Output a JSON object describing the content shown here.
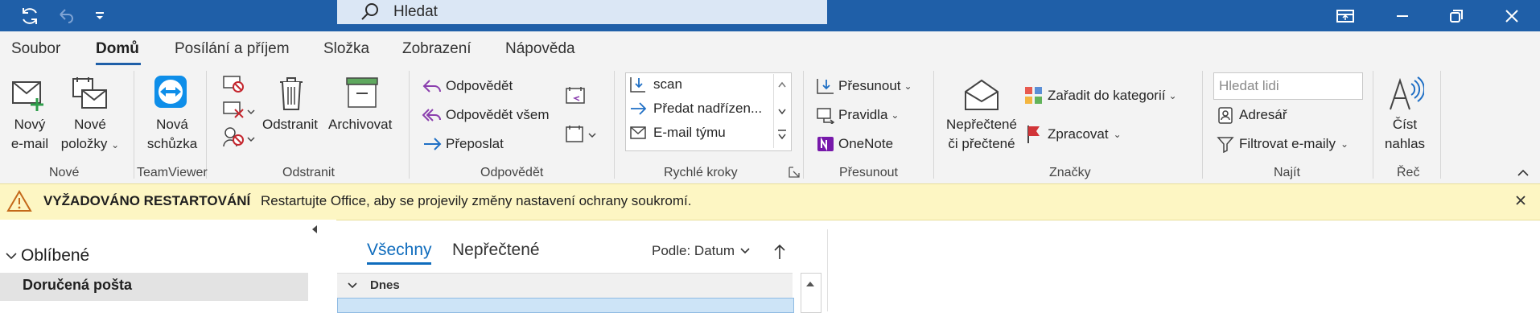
{
  "search": {
    "placeholder": "Hledat"
  },
  "tabs": [
    {
      "label": "Soubor"
    },
    {
      "label": "Domů"
    },
    {
      "label": "Posílání a příjem"
    },
    {
      "label": "Složka"
    },
    {
      "label": "Zobrazení"
    },
    {
      "label": "Nápověda"
    }
  ],
  "ribbon": {
    "new_email": [
      "Nový",
      "e-mail"
    ],
    "new_items": [
      "Nové",
      "položky"
    ],
    "new_meeting": [
      "Nová",
      "schůzka"
    ],
    "delete": "Odstranit",
    "archive": "Archivovat",
    "reply": "Odpovědět",
    "reply_all": "Odpovědět všem",
    "forward": "Přeposlat",
    "quick_steps": [
      "scan",
      "Předat nadřízen...",
      "E-mail týmu"
    ],
    "move": "Přesunout",
    "rules": "Pravidla",
    "onenote": "OneNote",
    "unread_read": [
      "Nepřečtené",
      "či přečtené"
    ],
    "categorize": "Zařadit do kategorií",
    "follow_up": "Zpracovat",
    "search_people_placeholder": "Hledat lidi",
    "address_book": "Adresář",
    "filter_email": "Filtrovat e-maily",
    "read_aloud": [
      "Číst",
      "nahlas"
    ],
    "groups": {
      "new": "Nové",
      "teamviewer": "TeamViewer",
      "delete": "Odstranit",
      "respond": "Odpovědět",
      "quick_steps": "Rychlé kroky",
      "move": "Přesunout",
      "tags": "Značky",
      "find": "Najít",
      "speech": "Řeč"
    }
  },
  "banner": {
    "title": "VYŽADOVÁNO RESTARTOVÁNÍ",
    "message": "Restartujte Office, aby se projevily změny nastavení ochrany soukromí."
  },
  "folders": {
    "favorites": "Oblíbené",
    "inbox": "Doručená pošta"
  },
  "maillist": {
    "tab_all": "Všechny",
    "tab_unread": "Nepřečtené",
    "sort": "Podle: Datum",
    "today": "Dnes"
  },
  "colors": {
    "brand": "#1f5fa8",
    "banner_bg": "#fdf6c3",
    "accent": "#0f6cbd"
  }
}
